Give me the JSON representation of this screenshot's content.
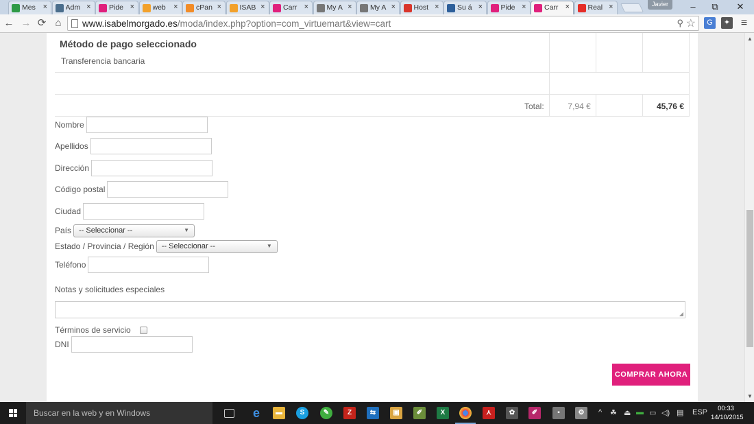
{
  "browser": {
    "tabs": [
      {
        "label": "Mes",
        "icon": "green-sheet-icon",
        "color": "#2e9a46"
      },
      {
        "label": "Adm",
        "icon": "admin-page-icon",
        "color": "#4a6d8c"
      },
      {
        "label": "Pide",
        "icon": "shop-logo-icon",
        "color": "#e0207c"
      },
      {
        "label": "web",
        "icon": "joomla-icon",
        "color": "#f2a12b"
      },
      {
        "label": "cPan",
        "icon": "cpanel-icon",
        "color": "#f28c28"
      },
      {
        "label": "ISAB",
        "icon": "joomla-icon",
        "color": "#f2a12b"
      },
      {
        "label": "Carr",
        "icon": "shop-logo-icon",
        "color": "#e0207c"
      },
      {
        "label": "My A",
        "icon": "github-icon",
        "color": "#777777"
      },
      {
        "label": "My A",
        "icon": "github-icon",
        "color": "#777777"
      },
      {
        "label": "Host",
        "icon": "hosting-icon",
        "color": "#d9352b"
      },
      {
        "label": "Su á",
        "icon": "wix-icon",
        "color": "#2d5f9a"
      },
      {
        "label": "Pide",
        "icon": "shop-logo-icon",
        "color": "#e0207c"
      },
      {
        "label": "Carr",
        "icon": "shop-logo-icon",
        "color": "#e0207c"
      },
      {
        "label": "Real",
        "icon": "youtube-icon",
        "color": "#e52d27"
      }
    ],
    "profile_name": "Javier",
    "url_host": "www.isabelmorgado.es",
    "url_path": "/moda/index.php?option=com_virtuemart&view=cart"
  },
  "cart": {
    "payment_heading": "Método de pago seleccionado",
    "payment_method": "Transferencia bancaria",
    "total_label": "Total:",
    "tax_total": "7,94 €",
    "grand_total": "45,76 €"
  },
  "form": {
    "fields": [
      {
        "label": "Nombre",
        "value": ""
      },
      {
        "label": "Apellidos",
        "value": ""
      },
      {
        "label": "Dirección",
        "value": ""
      },
      {
        "label": "Código postal",
        "value": ""
      },
      {
        "label": "Ciudad",
        "value": ""
      },
      {
        "label": "País",
        "value": "-- Seleccionar --"
      },
      {
        "label": "Estado / Provincia / Región",
        "value": "-- Seleccionar --"
      },
      {
        "label": "Teléfono",
        "value": ""
      }
    ],
    "notes_label": "Notas y solicitudes especiales",
    "terms_label": "Términos de servicio",
    "terms_checked": false,
    "dni_label": "DNI",
    "dni_value": "",
    "submit_label": "COMPRAR AHORA",
    "accent_color": "#e0207c"
  },
  "taskbar": {
    "search_placeholder": "Buscar en la web y en Windows",
    "language": "ESP",
    "time": "00:33",
    "date": "14/10/2015"
  }
}
